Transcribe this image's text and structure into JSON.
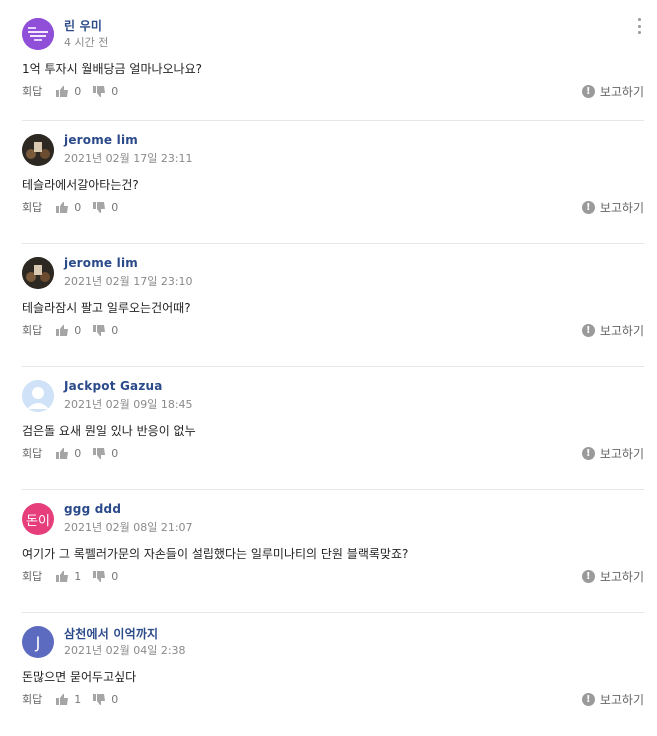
{
  "labels": {
    "reply": "회답",
    "report": "보고하기"
  },
  "comments": [
    {
      "author": "린 우미",
      "timestamp": "4 시간 전",
      "text": "1억 투자시 월배당금 얼마나오나요?",
      "likes": "0",
      "dislikes": "0",
      "avatar": {
        "type": "image",
        "color": "#7a3fc8",
        "icon": "profile-photo"
      }
    },
    {
      "author": "jerome lim",
      "timestamp": "2021년 02월 17일 23:11",
      "text": "테슬라에서갈아타는건?",
      "likes": "0",
      "dislikes": "0",
      "avatar": {
        "type": "image",
        "color": "#3a332c",
        "icon": "profile-photo"
      }
    },
    {
      "author": "jerome lim",
      "timestamp": "2021년 02월 17일 23:10",
      "text": "테슬라잠시 팔고 일루오는건어때?",
      "likes": "0",
      "dislikes": "0",
      "avatar": {
        "type": "image",
        "color": "#3a332c",
        "icon": "profile-photo"
      }
    },
    {
      "author": "Jackpot Gazua",
      "timestamp": "2021년 02월 09일 18:45",
      "text": "검은돌 요새 뭔일 있나 반응이 없누",
      "likes": "0",
      "dislikes": "0",
      "avatar": {
        "type": "default",
        "color": "#c9ddf5",
        "icon": "default-avatar"
      }
    },
    {
      "author": "ggg ddd",
      "timestamp": "2021년 02월 08일 21:07",
      "text": "여기가 그 록펠러가문의 자손들이 설립했다는 일루미나티의 단원 블랙록맞죠?",
      "likes": "1",
      "dislikes": "0",
      "avatar": {
        "type": "text",
        "color": "#e63e7a",
        "label": "돈이"
      }
    },
    {
      "author": "삼천에서 이억까지",
      "timestamp": "2021년 02월 04일 2:38",
      "text": "돈많으면 묻어두고싶다",
      "likes": "1",
      "dislikes": "0",
      "avatar": {
        "type": "text",
        "color": "#5c6bc0",
        "label": "J"
      }
    }
  ]
}
